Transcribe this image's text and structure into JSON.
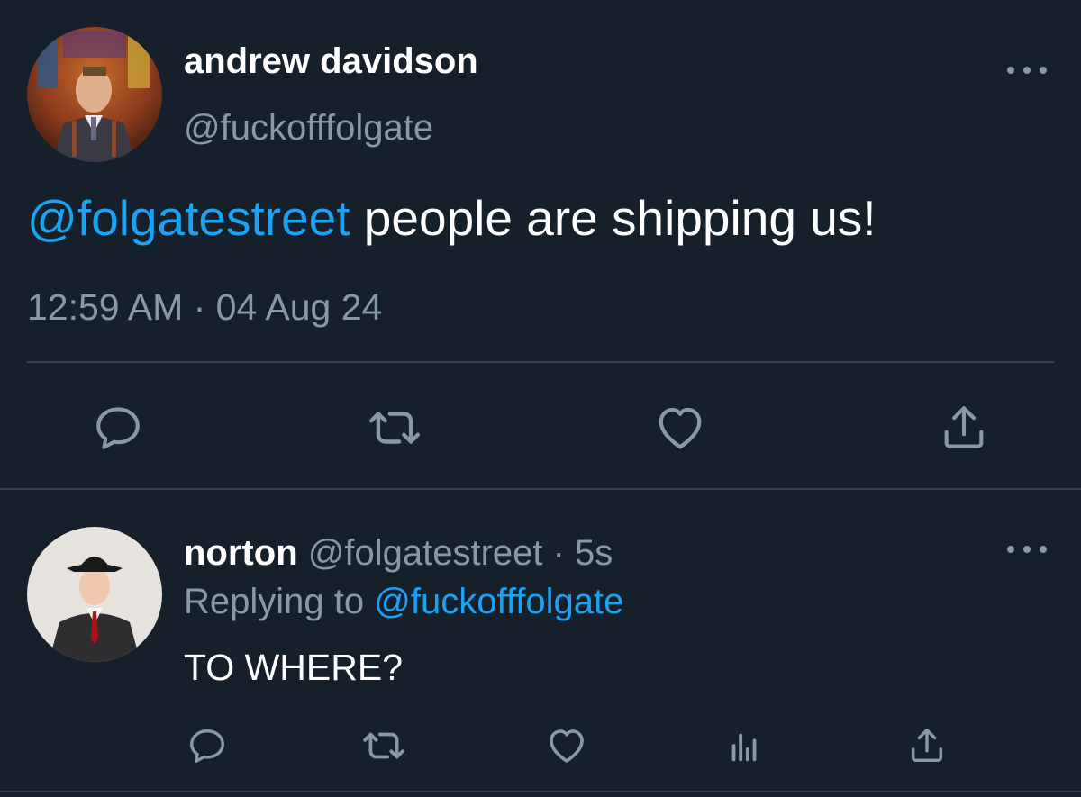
{
  "colors": {
    "background": "#15202b",
    "text_primary": "#ffffff",
    "text_secondary": "#8899a6",
    "accent": "#1da1f2",
    "divider": "#38444d"
  },
  "main_tweet": {
    "avatar_icon": "profile-photo-man-stained-glass",
    "display_name": "andrew davidson",
    "handle": "@fuckofffolgate",
    "text_mention": "@folgatestreet",
    "text_body": " people are shipping us!",
    "timestamp": "12:59 AM · 04 Aug 24",
    "actions": [
      {
        "name": "reply",
        "icon": "reply-icon"
      },
      {
        "name": "retweet",
        "icon": "retweet-icon"
      },
      {
        "name": "like",
        "icon": "heart-icon"
      },
      {
        "name": "share",
        "icon": "share-icon"
      }
    ]
  },
  "reply_tweet": {
    "avatar_icon": "profile-photo-man-fedora",
    "display_name": "norton",
    "handle": "@folgatestreet",
    "separator": " · ",
    "time_ago": "5s",
    "replying_to_prefix": "Replying to ",
    "replying_to_handle": "@fuckofffolgate",
    "text": "TO WHERE?",
    "actions": [
      {
        "name": "reply",
        "icon": "reply-icon"
      },
      {
        "name": "retweet",
        "icon": "retweet-icon"
      },
      {
        "name": "like",
        "icon": "heart-icon"
      },
      {
        "name": "analytics",
        "icon": "analytics-icon"
      },
      {
        "name": "share",
        "icon": "share-icon"
      }
    ]
  }
}
